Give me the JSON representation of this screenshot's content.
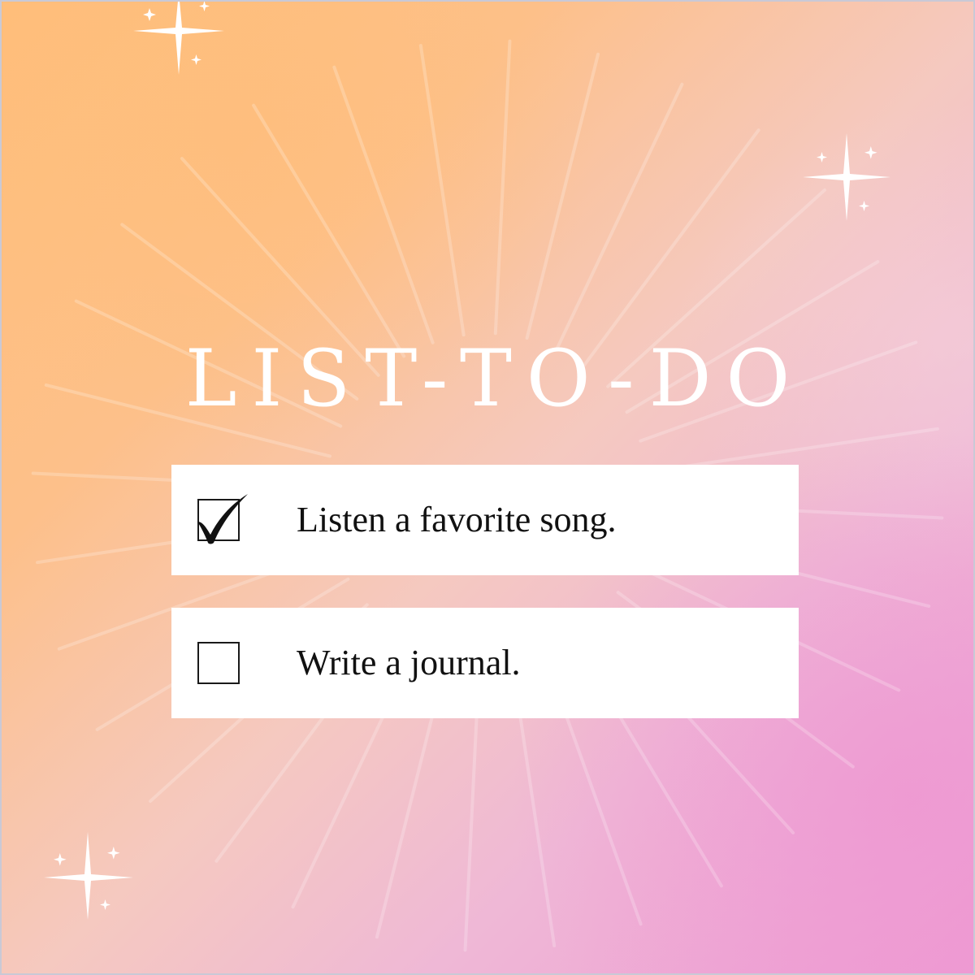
{
  "title": "LIST-TO-DO",
  "tasks": [
    {
      "label": "Listen a favorite song.",
      "checked": true
    },
    {
      "label": "Write a journal.",
      "checked": false
    }
  ],
  "colors": {
    "gradient_top_left": "#ffbe7a",
    "gradient_bottom_right": "#ee9bd3",
    "title_color": "#ffffff",
    "card_background": "#ffffff",
    "text_color": "#111111"
  },
  "icons": {
    "checked": "checkmark-icon",
    "unchecked": "empty-checkbox-icon",
    "decoration": "sparkle-icon"
  }
}
